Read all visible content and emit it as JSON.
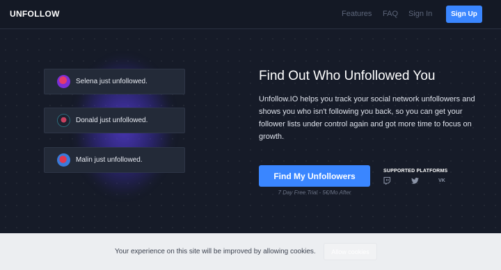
{
  "nav": {
    "logo": "UNFOLLOW",
    "features": "Features",
    "faq": "FAQ",
    "signin": "Sign In",
    "signup": "Sign Up"
  },
  "cards": [
    {
      "name": "Selena",
      "action": "just unfollowed.",
      "text": "Selena just unfollowed."
    },
    {
      "name": "Donald",
      "action": "just unfollowed.",
      "text": "Donald just unfollowed."
    },
    {
      "name": "Malin",
      "action": "just unfollowed.",
      "text": "Malin just unfollowed."
    }
  ],
  "hero": {
    "title": "Find Out Who Unfollowed You",
    "description": "Unfollow.IO helps you track your social network unfollowers and shows you who isn't following you back, so you can get your follower lists under control again and got more time to focus on growth.",
    "cta": "Find My Unfollowers",
    "trial_note": "7 Day Free Trial - 5€/Mo After"
  },
  "platforms": {
    "title": "SUPPORTED PLATFORMS",
    "icons": [
      "twitch-icon",
      "twitter-icon",
      "vk-icon"
    ],
    "vk_label": "VK"
  },
  "cookie": {
    "text": "Your experience on this site will be improved by allowing cookies.",
    "button": "Allow cookies"
  },
  "colors": {
    "accent": "#3a86ff",
    "background": "#171c2a",
    "glow": "#5c40e6"
  }
}
